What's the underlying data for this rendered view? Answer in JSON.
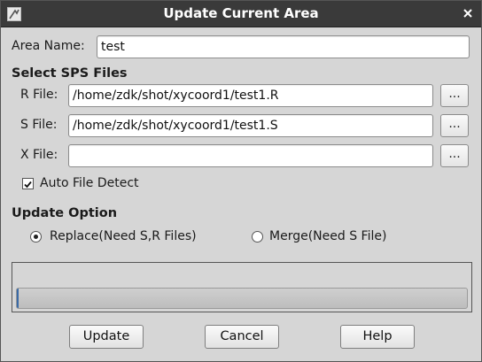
{
  "window": {
    "title": "Update Current Area"
  },
  "area": {
    "label": "Area Name:",
    "value": "test"
  },
  "sps": {
    "heading": "Select SPS Files",
    "r_file": {
      "label": "R File:",
      "value": "/home/zdk/shot/xycoord1/test1.R",
      "browse": "..."
    },
    "s_file": {
      "label": "S File:",
      "value": "/home/zdk/shot/xycoord1/test1.S",
      "browse": "..."
    },
    "x_file": {
      "label": "X File:",
      "value": "",
      "browse": "..."
    },
    "auto_detect": {
      "label": "Auto File Detect",
      "checked": true
    }
  },
  "update_option": {
    "heading": "Update Option",
    "replace": {
      "label": "Replace(Need S,R Files)",
      "selected": true
    },
    "merge": {
      "label": "Merge(Need S File)",
      "selected": false
    }
  },
  "progress": {
    "fraction": 0.0
  },
  "buttons": {
    "update": "Update",
    "cancel": "Cancel",
    "help": "Help"
  },
  "icons": {
    "window_icon": "app-window-icon",
    "close": "close-icon",
    "check": "checkmark-icon"
  }
}
